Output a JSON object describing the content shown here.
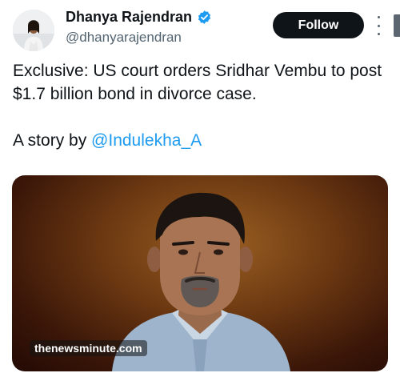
{
  "author": {
    "display_name": "Dhanya Rajendran",
    "handle": "@dhanyarajendran",
    "verified": true,
    "avatar_icon": "profile-photo"
  },
  "actions": {
    "follow_label": "Follow",
    "more_icon": "more-vertical-icon"
  },
  "tweet": {
    "line1": "Exclusive: US court orders Sridhar Vembu to post $1.7 billion bond in divorce case.",
    "line2_prefix": "A story by ",
    "mention": "@Indulekha_A"
  },
  "media": {
    "watermark": "thenewsminute.com"
  },
  "colors": {
    "accent": "#1d9bf0",
    "text": "#0f1419",
    "secondary": "#536471",
    "button_bg": "#0f1419"
  }
}
